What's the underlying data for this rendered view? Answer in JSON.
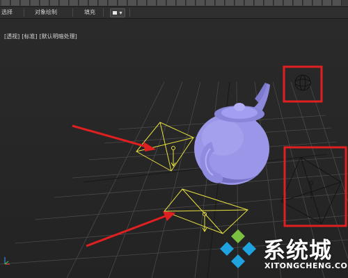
{
  "ribbon": {
    "item_select": "选择",
    "item_object_paint": "对象绘制",
    "item_fill": "填充",
    "dropdown_arrow": "▾"
  },
  "viewport": {
    "label_view": "[+]",
    "label_perspective": "[透视]",
    "label_standard": "[标准]",
    "label_shading": "[默认明暗处理]"
  },
  "watermark": {
    "text": "系统城",
    "url": "XITONGCHENG.COM",
    "colors": {
      "green": "#7ac143",
      "blue": "#1fa3e0"
    }
  },
  "annotations": {
    "arrow_color": "#e02020",
    "box_color": "#e02020"
  },
  "scene": {
    "teapot_color": "#9a96e8",
    "gizmo_color": "#e8e040"
  }
}
